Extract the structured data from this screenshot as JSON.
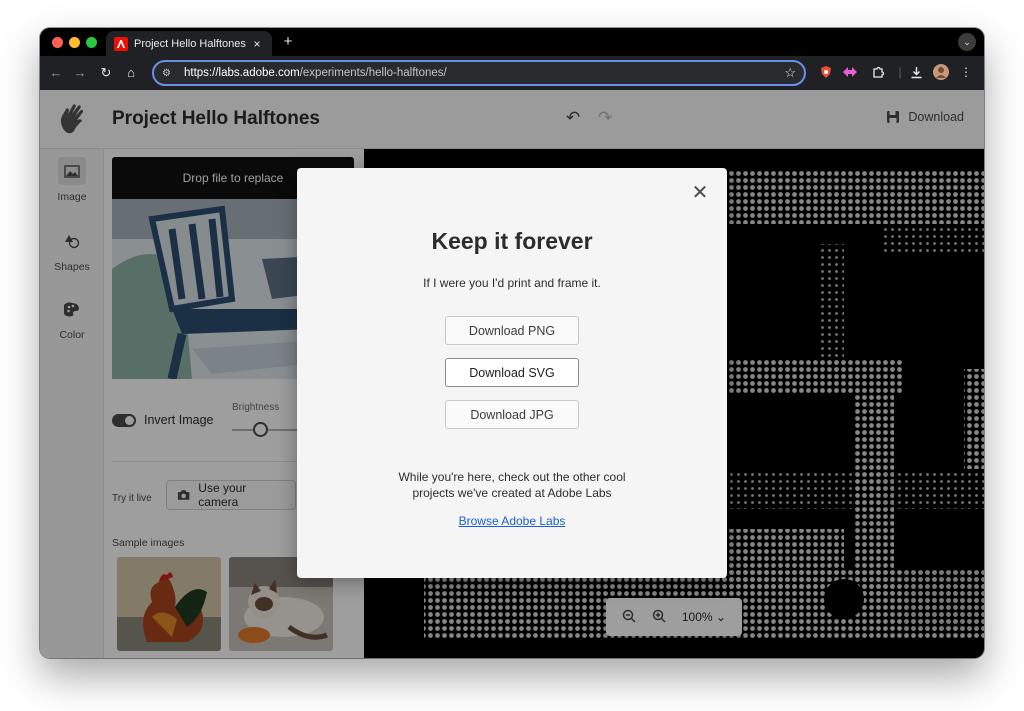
{
  "browser": {
    "tab_title": "Project Hello Halftones",
    "tab_close": "×",
    "new_tab": "+",
    "url_host": "https://labs.adobe.com",
    "url_path": "/experiments/hello-halftones/"
  },
  "app": {
    "title": "Project Hello Halftones",
    "download_label": "Download",
    "rail": [
      {
        "label": "Image",
        "icon": "image-icon"
      },
      {
        "label": "Shapes",
        "icon": "shapes-icon"
      },
      {
        "label": "Color",
        "icon": "palette-icon"
      }
    ],
    "drop_label": "Drop file to replace",
    "invert_label": "Invert Image",
    "invert_on": true,
    "brightness_label": "Brightness",
    "try_live_label": "Try it live",
    "camera_label": "Use your camera",
    "sample_label": "Sample images",
    "zoom_level": "100%"
  },
  "modal": {
    "title": "Keep it forever",
    "subtitle": "If I were you I'd print and frame it.",
    "buttons": [
      "Download PNG",
      "Download SVG",
      "Download JPG"
    ],
    "note_line1": "While you're here, check out the other cool",
    "note_line2": "projects we've created at Adobe Labs",
    "link": "Browse Adobe Labs"
  },
  "colors": {
    "accent_link": "#1a5fd3",
    "omnibox_focus": "#6b8fe6",
    "adobe_red": "#eb1000"
  }
}
